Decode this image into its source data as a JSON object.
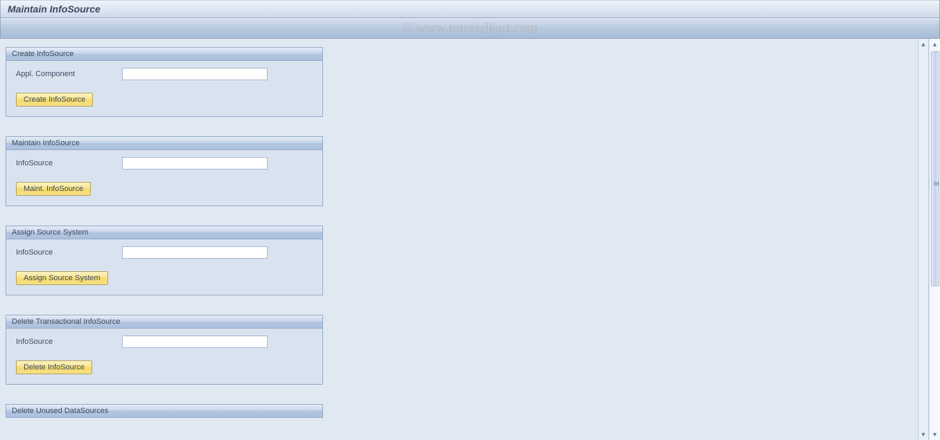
{
  "title": "Maintain InfoSource",
  "watermark": "© www.tutorialkart.com",
  "panels": {
    "create": {
      "header": "Create InfoSource",
      "label": "Appl. Component",
      "value": "",
      "button": "Create InfoSource"
    },
    "maintain": {
      "header": "Maintain InfoSource",
      "label": "InfoSource",
      "value": "",
      "button": "Maint. InfoSource"
    },
    "assign": {
      "header": "Assign Source System",
      "label": "InfoSource",
      "value": "",
      "button": "Assign Source System"
    },
    "delete_trans": {
      "header": "Delete Transactional InfoSource",
      "label": "InfoSource",
      "value": "",
      "button": "Delete InfoSource"
    },
    "delete_unused": {
      "header": "Delete Unused DataSources"
    }
  }
}
